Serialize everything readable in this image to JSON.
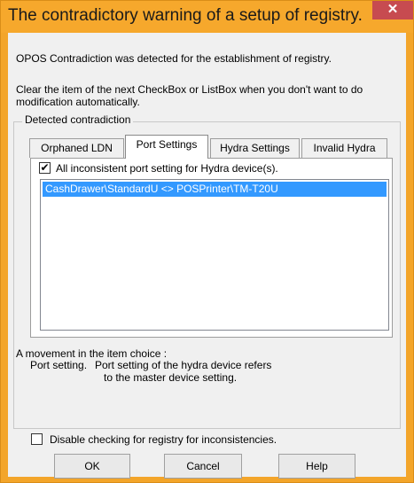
{
  "window": {
    "title": "The contradictory warning of a setup of registry.",
    "close_glyph": "✕"
  },
  "messages": {
    "detected": "OPOS Contradiction was detected for the establishment of registry.",
    "instruction": "Clear the item of the next CheckBox or ListBox when you don't want to do modification automatically."
  },
  "group": {
    "label": "Detected contradiction"
  },
  "tabs": [
    {
      "label": "Orphaned LDN",
      "active": false
    },
    {
      "label": "Port Settings",
      "active": true
    },
    {
      "label": "Hydra Settings",
      "active": false
    },
    {
      "label": "Invalid Hydra",
      "active": false
    }
  ],
  "panel": {
    "checkbox_label": "All inconsistent port setting for Hydra device(s).",
    "checkbox_checked": true,
    "list_items": [
      "CashDrawer\\StandardU <> POSPrinter\\TM-T20U"
    ]
  },
  "movement": {
    "title": "A movement in the item choice :",
    "key": "Port setting.",
    "desc_line1": "Port setting of the hydra device refers",
    "desc_line2": "to the master device setting."
  },
  "footer": {
    "disable_label": "Disable checking for registry for inconsistencies.",
    "disable_checked": false
  },
  "buttons": {
    "ok": "OK",
    "cancel": "Cancel",
    "help": "Help"
  },
  "colors": {
    "title_bar": "#f6a82c",
    "close_button": "#c74b50",
    "selection": "#3399ff"
  }
}
